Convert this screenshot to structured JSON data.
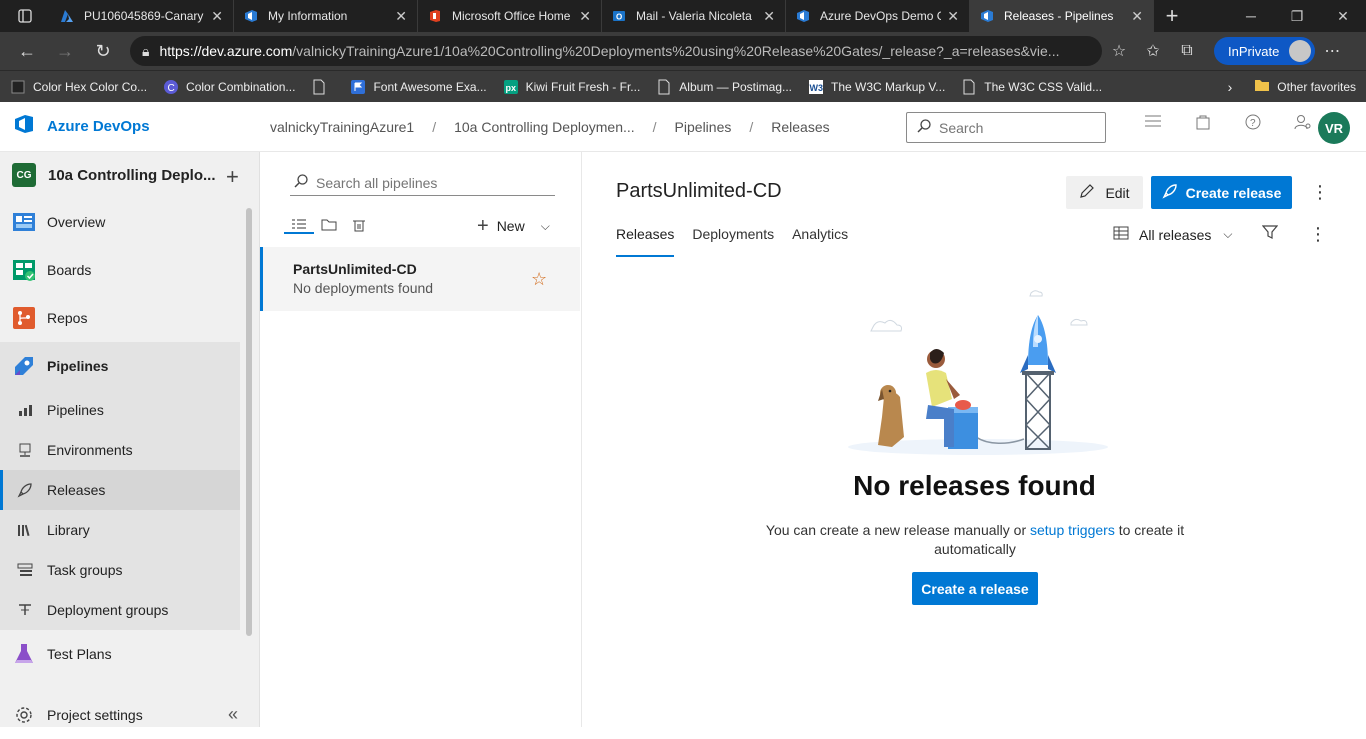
{
  "browser": {
    "tabs": [
      {
        "title": "PU106045869-Canary",
        "icon": "azure-icon",
        "color": "#2a7bd4"
      },
      {
        "title": "My Information",
        "icon": "azure-devops-icon",
        "color": "#2a7bd4"
      },
      {
        "title": "Microsoft Office Home",
        "icon": "office-icon",
        "color": "#e0401f"
      },
      {
        "title": "Mail - Valeria Nicoleta",
        "icon": "outlook-icon",
        "color": "#1a73c8"
      },
      {
        "title": "Azure DevOps Demo G",
        "icon": "azure-devops-icon",
        "color": "#2a7bd4"
      },
      {
        "title": "Releases - Pipelines",
        "icon": "azure-devops-icon",
        "color": "#2a7bd4",
        "active": true
      }
    ],
    "url_domain": "https://dev.azure.com",
    "url_path": "/valnickyTrainingAzure1/10a%20Controlling%20Deployments%20using%20Release%20Gates/_release?_a=releases&vie...",
    "inprivate_label": "InPrivate",
    "favorites": [
      "Color Hex Color Co...",
      "Color Combination...",
      "",
      "Font Awesome Exa...",
      "Kiwi Fruit Fresh - Fr...",
      "Album — Postimag...",
      "The W3C Markup V...",
      "The W3C CSS Valid..."
    ],
    "other_favorites": "Other favorites"
  },
  "header": {
    "brand": "Azure DevOps",
    "breadcrumbs": [
      "valnickyTrainingAzure1",
      "10a Controlling Deploymen...",
      "Pipelines",
      "Releases"
    ],
    "search_placeholder": "Search",
    "avatar_initials": "VR"
  },
  "leftnav": {
    "project_badge": "CG",
    "project_name": "10a Controlling Deplo...",
    "items": {
      "overview": "Overview",
      "boards": "Boards",
      "repos": "Repos",
      "pipelines": "Pipelines",
      "test_plans": "Test Plans",
      "project_settings": "Project settings"
    },
    "pipeline_subitems": {
      "pipelines": "Pipelines",
      "environments": "Environments",
      "releases": "Releases",
      "library": "Library",
      "task_groups": "Task groups",
      "deployment_groups": "Deployment groups"
    }
  },
  "list": {
    "search_placeholder": "Search all pipelines",
    "new_label": "New",
    "item_title": "PartsUnlimited-CD",
    "item_subtitle": "No deployments found"
  },
  "main": {
    "title": "PartsUnlimited-CD",
    "edit_label": "Edit",
    "create_release_label": "Create release",
    "tabs": [
      "Releases",
      "Deployments",
      "Analytics"
    ],
    "view_filter": "All releases",
    "empty_title": "No releases found",
    "empty_desc_before": "You can create a new release manually or ",
    "empty_desc_link": "setup triggers",
    "empty_desc_after": " to create it automatically",
    "create_button": "Create a release"
  },
  "colors": {
    "accent": "#0078d4",
    "avatar_bg": "#1b7a5a"
  }
}
